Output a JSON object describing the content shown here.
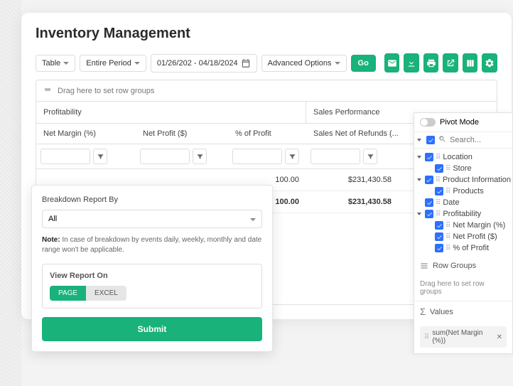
{
  "page": {
    "title": "Inventory Management"
  },
  "toolbar": {
    "view_select": "Table",
    "period_select": "Entire Period",
    "date_range": "01/26/202 - 04/18/2024",
    "adv_options": "Advanced Options",
    "go": "Go"
  },
  "grid": {
    "drag_hint": "Drag here to set row groups",
    "groups": {
      "profitability": "Profitability",
      "sales_perf": "Sales Performance"
    },
    "cols": {
      "net_margin": "Net Margin (%)",
      "net_profit": "Net Profit ($)",
      "pct_profit": "% of Profit",
      "sales_net": "Sales Net of Refunds (..."
    },
    "rows": [
      {
        "pct_profit": "100.00",
        "sales_net": "$231,430.58"
      },
      {
        "pct_profit": "100.00",
        "sales_net": "$231,430.58"
      }
    ]
  },
  "modal": {
    "label": "Breakdown Report By",
    "select_value": "All",
    "note_prefix": "Note:",
    "note_body": " In case of breakdown by events daily, weekly, monthly and date range won't be applicable.",
    "view_label": "View Report On",
    "page_btn": "PAGE",
    "excel_btn": "EXCEL",
    "submit": "Submit"
  },
  "panel": {
    "pivot_label": "Pivot Mode",
    "search_placeholder": "Search...",
    "tree": {
      "location": "Location",
      "store": "Store",
      "product_info": "Product Information",
      "products": "Products",
      "date": "Date",
      "profitability": "Profitability",
      "net_margin": "Net Margin (%)",
      "net_profit": "Net Profit ($)",
      "pct_profit": "% of Profit"
    },
    "row_groups_title": "Row Groups",
    "row_groups_hint": "Drag here to set row groups",
    "values_title": "Values",
    "value_chip": "sum(Net Margin (%))"
  }
}
